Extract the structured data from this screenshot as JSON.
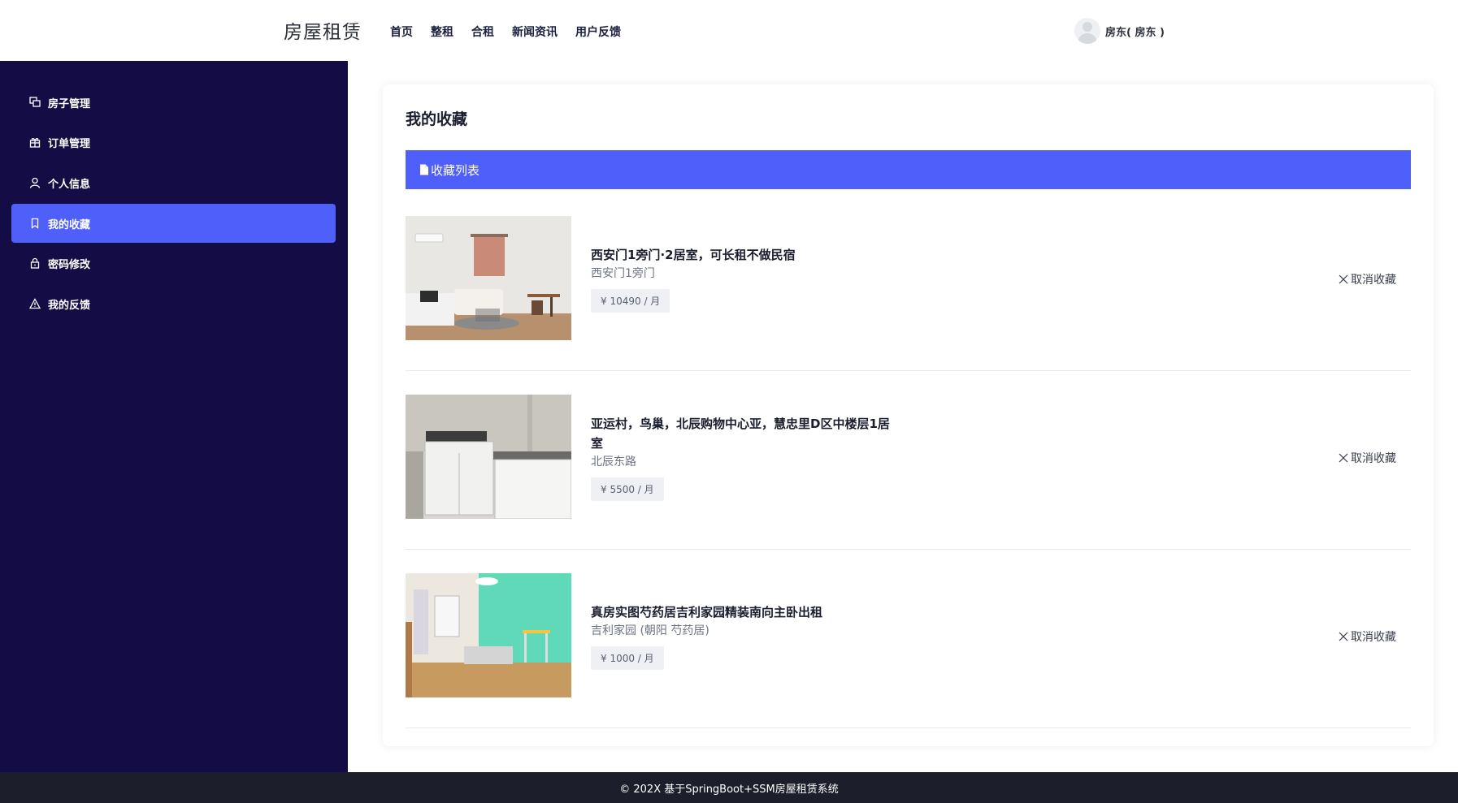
{
  "header": {
    "logo": "房屋租赁",
    "nav": [
      "首页",
      "整租",
      "合租",
      "新闻资讯",
      "用户反馈"
    ],
    "user_name": "房东( 房东 )"
  },
  "sidebar": {
    "items": [
      {
        "label": "房子管理",
        "icon": "house-manage-icon"
      },
      {
        "label": "订单管理",
        "icon": "gift-icon"
      },
      {
        "label": "个人信息",
        "icon": "user-icon"
      },
      {
        "label": "我的收藏",
        "icon": "bookmark-icon",
        "active": true
      },
      {
        "label": "密码修改",
        "icon": "lock-icon"
      },
      {
        "label": "我的反馈",
        "icon": "warning-icon"
      }
    ],
    "active_color": "#4f5ffa",
    "bg_color": "#140c44"
  },
  "main": {
    "title": "我的收藏",
    "list_header": "收藏列表",
    "favorites": [
      {
        "title": "西安门1旁门·2居室，可长租不做民宿",
        "address": "西安门1旁门",
        "price": "¥ 10490 / 月",
        "cancel_label": "取消收藏",
        "image": "bedroom-photo"
      },
      {
        "title": "亚运村，鸟巢，北辰购物中心亚，慧忠里D区中楼层1居室",
        "address": "北辰东路",
        "price": "¥ 5500 / 月",
        "cancel_label": "取消收藏",
        "image": "kitchen-photo"
      },
      {
        "title": "真房实图芍药居吉利家园精装南向主卧出租",
        "address": "吉利家园 (朝阳 芍药居)",
        "price": "¥ 1000 / 月",
        "cancel_label": "取消收藏",
        "image": "green-bedroom-photo"
      }
    ]
  },
  "footer": {
    "text": "© 202X 基于SpringBoot+SSM房屋租赁系统"
  }
}
